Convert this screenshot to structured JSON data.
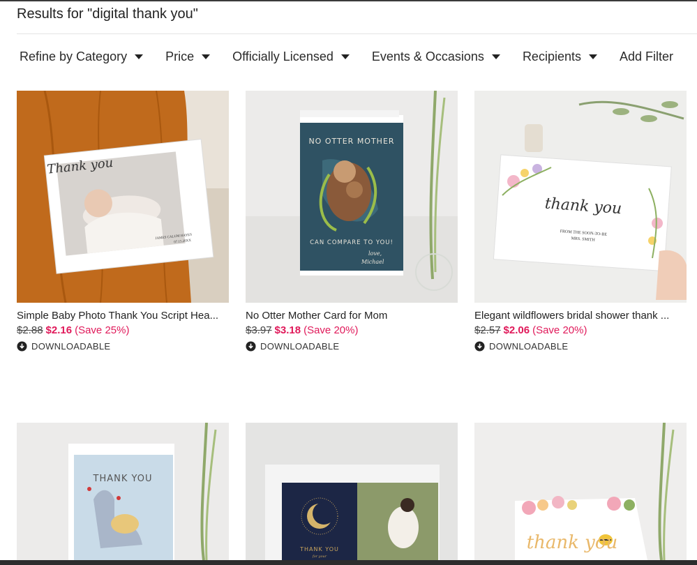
{
  "search": {
    "results_label": "Results for \"digital thank you\""
  },
  "filters": [
    {
      "label": "Refine by Category"
    },
    {
      "label": "Price"
    },
    {
      "label": "Officially Licensed"
    },
    {
      "label": "Events & Occasions"
    },
    {
      "label": "Recipients"
    },
    {
      "label": "Add Filter"
    }
  ],
  "products": [
    {
      "title": "Simple Baby Photo Thank You Script Hea...",
      "old_price": "$2.88",
      "new_price": "$2.16",
      "save": "(Save 25%)",
      "badge": "DOWNLOADABLE",
      "card_text": {
        "script": "Thank you",
        "name": "JAMES CALUM HAYES",
        "date": "07.15.20XX"
      }
    },
    {
      "title": "No Otter Mother Card for Mom",
      "old_price": "$3.97",
      "new_price": "$3.18",
      "save": "(Save 20%)",
      "badge": "DOWNLOADABLE",
      "card_text": {
        "top": "NO OTTER MOTHER",
        "bottom": "CAN COMPARE TO YOU!",
        "sign": "love,",
        "sign2": "Michael"
      }
    },
    {
      "title": "Elegant wildflowers bridal shower thank ...",
      "old_price": "$2.57",
      "new_price": "$2.06",
      "save": "(Save 20%)",
      "badge": "DOWNLOADABLE",
      "card_text": {
        "script": "thank you",
        "from": "FROM THE SOON-TO-BE",
        "name": "MRS. SMITH"
      }
    },
    {
      "card_text": {
        "top": "THANK YOU"
      }
    },
    {
      "card_text": {
        "top": "THANK YOU",
        "sub": "for your"
      }
    },
    {
      "card_text": {
        "script": "thank you"
      }
    }
  ],
  "colors": {
    "sale": "#e0195a",
    "text": "#222222"
  },
  "icons": {
    "caret": "chevron-down-icon",
    "download": "download-circle-icon"
  }
}
